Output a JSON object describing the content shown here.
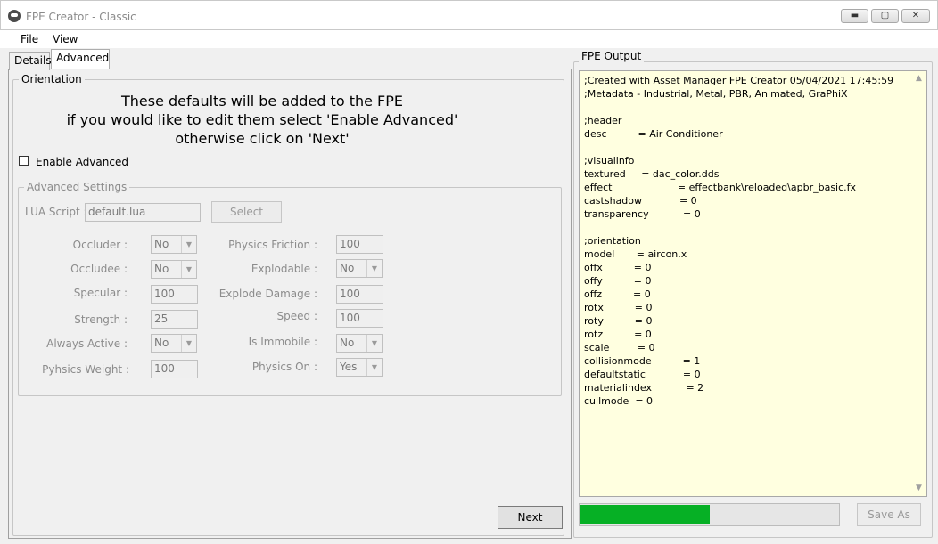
{
  "window": {
    "title": "FPE Creator - Classic",
    "controls": {
      "minimize": "▬",
      "maximize": "▢",
      "close": "✕"
    }
  },
  "menu": {
    "file": "File",
    "view": "View"
  },
  "tabs": {
    "details": "Details",
    "advanced": "Advanced"
  },
  "orientation": {
    "legend": "Orientation",
    "info_lines": [
      "These defaults will be added to the FPE",
      "if you would like to edit them select 'Enable Advanced'",
      "otherwise click on 'Next'"
    ],
    "enable_advanced_label": "Enable Advanced",
    "enable_advanced_checked": false
  },
  "advanced_settings": {
    "legend": "Advanced Settings",
    "lua_script_label": "LUA Script :",
    "lua_script_value": "default.lua",
    "select_button": "Select",
    "occluder_label": "Occluder :",
    "occluder_value": "No",
    "occludee_label": "Occludee :",
    "occludee_value": "No",
    "specular_label": "Specular :",
    "specular_value": "100",
    "strength_label": "Strength :",
    "strength_value": "25",
    "always_active_label": "Always Active :",
    "always_active_value": "No",
    "physics_weight_label": "Pyhsics Weight :",
    "physics_weight_value": "100",
    "physics_friction_label": "Physics Friction :",
    "physics_friction_value": "100",
    "explodable_label": "Explodable :",
    "explodable_value": "No",
    "explode_damage_label": "Explode Damage :",
    "explode_damage_value": "100",
    "speed_label": "Speed :",
    "speed_value": "100",
    "is_immobile_label": "Is Immobile :",
    "is_immobile_value": "No",
    "physics_on_label": "Physics On :",
    "physics_on_value": "Yes"
  },
  "next_button": "Next",
  "output": {
    "legend": "FPE Output",
    "text": ";Created with Asset Manager FPE Creator 05/04/2021 17:45:59\n;Metadata - Industrial, Metal, PBR, Animated, GraPhiX\n\n;header\ndesc          = Air Conditioner\n\n;visualinfo\ntextured     = dac_color.dds\neffect                     = effectbank\\reloaded\\apbr_basic.fx\ncastshadow            = 0\ntransparency           = 0\n\n;orientation\nmodel       = aircon.x\noffx          = 0\noffy          = 0\noffz          = 0\nrotx          = 0\nroty          = 0\nrotz          = 0\nscale         = 0\ncollisionmode          = 1\ndefaultstatic            = 0\nmaterialindex           = 2\ncullmode  = 0",
    "progress_percent": 50,
    "save_as_button": "Save As"
  },
  "colors": {
    "output_background": "#ffffe0",
    "progress_fill": "#06b025"
  },
  "icons": {
    "scroll_up": "▲",
    "scroll_down": "▼",
    "dropdown": "▼"
  }
}
